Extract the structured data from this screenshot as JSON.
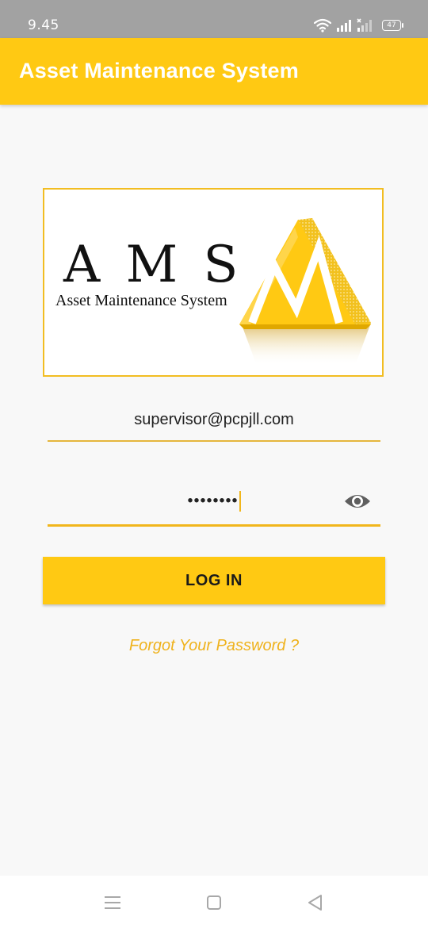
{
  "status_bar": {
    "time": "9.45",
    "battery": "47",
    "icons": [
      "wifi-icon",
      "signal-icon",
      "no-signal-icon",
      "battery-icon"
    ]
  },
  "app_bar": {
    "title": "Asset Maintenance System"
  },
  "logo": {
    "letters": "A M S",
    "caption": "Asset Maintenance System",
    "emblem_letter": "M"
  },
  "login_form": {
    "email_value": "supervisor@pcpjll.com",
    "password_value": "••••••••",
    "login_button_label": "LOG IN",
    "forgot_password_label": "Forgot Your Password ?"
  },
  "nav_bar": {
    "icons": [
      "menu-icon",
      "home-square-icon",
      "back-triangle-icon"
    ]
  },
  "colors": {
    "accent": "#ffc913",
    "status_bar": "#a2a2a2",
    "background": "#f8f8f8",
    "link": "#efb21c",
    "underline": "#f1b61c"
  }
}
